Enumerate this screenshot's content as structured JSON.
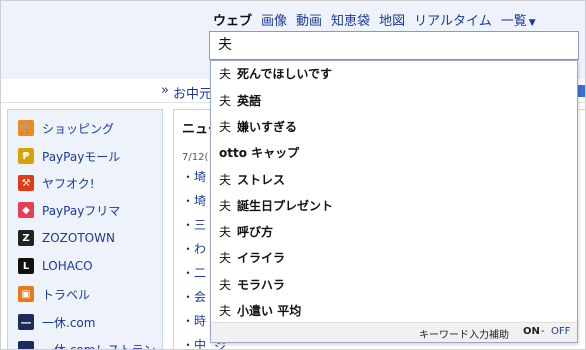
{
  "header": {
    "tabs": [
      {
        "label": "ウェブ",
        "active": true
      },
      {
        "label": "画像"
      },
      {
        "label": "動画"
      },
      {
        "label": "知恵袋"
      },
      {
        "label": "地図"
      },
      {
        "label": "リアルタイム"
      },
      {
        "label": "一覧"
      }
    ],
    "search_value": "夫"
  },
  "stripe": {
    "text": "お中元"
  },
  "sidebar": {
    "items": [
      {
        "label": "ショッピング",
        "icon": "cart-icon"
      },
      {
        "label": "PayPayモール",
        "icon": "bag-icon"
      },
      {
        "label": "ヤフオク!",
        "icon": "gavel-icon"
      },
      {
        "label": "PayPayフリマ",
        "icon": "tag-icon"
      },
      {
        "label": "ZOZOTOWN",
        "icon": "zozo-icon"
      },
      {
        "label": "LOHACO",
        "icon": "lohaco-icon"
      },
      {
        "label": "トラベル",
        "icon": "suitcase-icon"
      },
      {
        "label": "一休.com",
        "icon": "ikyu-icon"
      },
      {
        "label": "一休.comレストラン",
        "icon": "ikyu-restaurant-icon"
      }
    ]
  },
  "news": {
    "head": "ニュー",
    "date": "7/12(",
    "lines": [
      "・埼",
      "・埼",
      "・三",
      "・わ",
      "・二",
      "・会",
      "・時",
      "・中"
    ],
    "bottom": "ジ"
  },
  "suggest": {
    "query": "夫",
    "items": [
      {
        "query": "夫",
        "rest": "死んでほしいです"
      },
      {
        "query": "夫",
        "rest": "英語"
      },
      {
        "query": "夫",
        "rest": "嫌いすぎる"
      },
      {
        "query": "",
        "rest": "otto キャップ"
      },
      {
        "query": "夫",
        "rest": "ストレス"
      },
      {
        "query": "夫",
        "rest": "誕生日プレゼント"
      },
      {
        "query": "夫",
        "rest": "呼び方"
      },
      {
        "query": "夫",
        "rest": "イライラ"
      },
      {
        "query": "夫",
        "rest": "モラハラ"
      },
      {
        "query": "夫",
        "rest": "小遣い 平均"
      }
    ],
    "footer": {
      "label": "キーワード入力補助",
      "on": "ON",
      "dash": "-",
      "off": "OFF"
    }
  }
}
